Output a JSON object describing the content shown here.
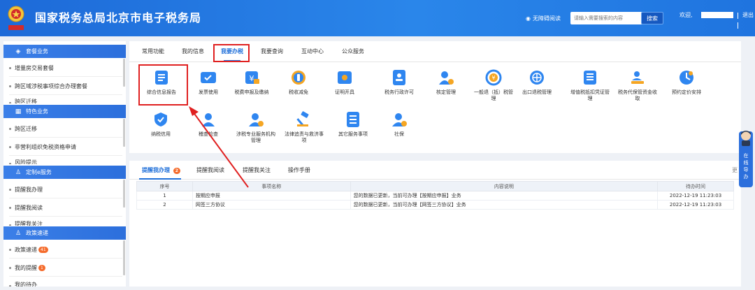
{
  "header": {
    "site_title": "国家税务总局北京市电子税务局",
    "accessibility_label": "无障碍阅读",
    "search_placeholder": "请输入需要搜索的内容",
    "search_button": "搜索",
    "welcome_label": "欢迎,",
    "logout_label": "退出"
  },
  "sidebar": {
    "sections": [
      {
        "title": "套餐业务",
        "icon": "stack-icon",
        "items": [
          "增量房交易套餐",
          "跨区域涉税事项综合办理套餐",
          "跨区迁移"
        ]
      },
      {
        "title": "特色业务",
        "icon": "grid-icon",
        "items": [
          "跨区迁移",
          "非营利组织免税资格申请",
          "风险提示"
        ]
      },
      {
        "title": "定制e服务",
        "icon": "user-icon",
        "items": [
          "提醒我办理",
          "提醒我阅读",
          "提醒我关注"
        ]
      },
      {
        "title": "政策速递",
        "icon": "user-icon",
        "items": [
          {
            "label": "政策速递",
            "badge": "41"
          },
          {
            "label": "我的提醒",
            "badge": "1"
          },
          {
            "label": "我的待办",
            "badge": ""
          }
        ]
      }
    ]
  },
  "top_tabs": [
    "常用功能",
    "我的信息",
    "我要办税",
    "我要查询",
    "互动中心",
    "公众服务"
  ],
  "active_top_tab": "我要办税",
  "functions_row1": [
    {
      "label": "综合信息报告",
      "icon": "document-icon"
    },
    {
      "label": "发票使用",
      "icon": "invoice-icon"
    },
    {
      "label": "税费申报及缴纳",
      "icon": "tax-payment-icon"
    },
    {
      "label": "税收减免",
      "icon": "tax-relief-icon"
    },
    {
      "label": "证明开具",
      "icon": "certificate-icon"
    },
    {
      "label": "税务行政许可",
      "icon": "admin-license-icon"
    },
    {
      "label": "核定管理",
      "icon": "assessment-icon"
    },
    {
      "label": "一般退（抵）税管理",
      "icon": "refund-icon"
    },
    {
      "label": "出口退税管理",
      "icon": "export-refund-icon"
    },
    {
      "label": "增值税抵扣凭证管理",
      "icon": "vat-voucher-icon"
    },
    {
      "label": "税务代保管资金收取",
      "icon": "custody-funds-icon"
    },
    {
      "label": "预约定价安排",
      "icon": "pricing-icon"
    }
  ],
  "functions_row2": [
    {
      "label": "纳税信用",
      "icon": "credit-icon"
    },
    {
      "label": "稽查检查",
      "icon": "inspection-icon"
    },
    {
      "label": "涉税专业服务机构管理",
      "icon": "agency-icon"
    },
    {
      "label": "法律追责与救济事项",
      "icon": "legal-icon"
    },
    {
      "label": "其它服务事项",
      "icon": "other-services-icon"
    },
    {
      "label": "社保",
      "icon": "social-security-icon"
    }
  ],
  "bottom_tabs": {
    "items": [
      {
        "label": "提醒我办理",
        "badge": "2"
      },
      {
        "label": "提醒我阅读",
        "badge": ""
      },
      {
        "label": "提醒我关注",
        "badge": ""
      },
      {
        "label": "操作手册",
        "badge": ""
      }
    ],
    "more": "更"
  },
  "table": {
    "headers": [
      "序号",
      "事项名称",
      "内容说明",
      "待办时间"
    ],
    "rows": [
      [
        "1",
        "按期应申报",
        "您的数据已更新，当前可办理【按期应申报】业务",
        "2022-12-19 11:23:03"
      ],
      [
        "2",
        "网签三方协议",
        "您的数据已更新，当前可办理【网签三方协议】业务",
        "2022-12-19 11:23:03"
      ]
    ]
  },
  "float_help": {
    "label_lines": [
      "在",
      "线",
      "导",
      "办"
    ]
  },
  "colors": {
    "brand_blue": "#1f6fd9",
    "highlight_red": "#e02020",
    "badge_orange": "#f56c2d"
  }
}
